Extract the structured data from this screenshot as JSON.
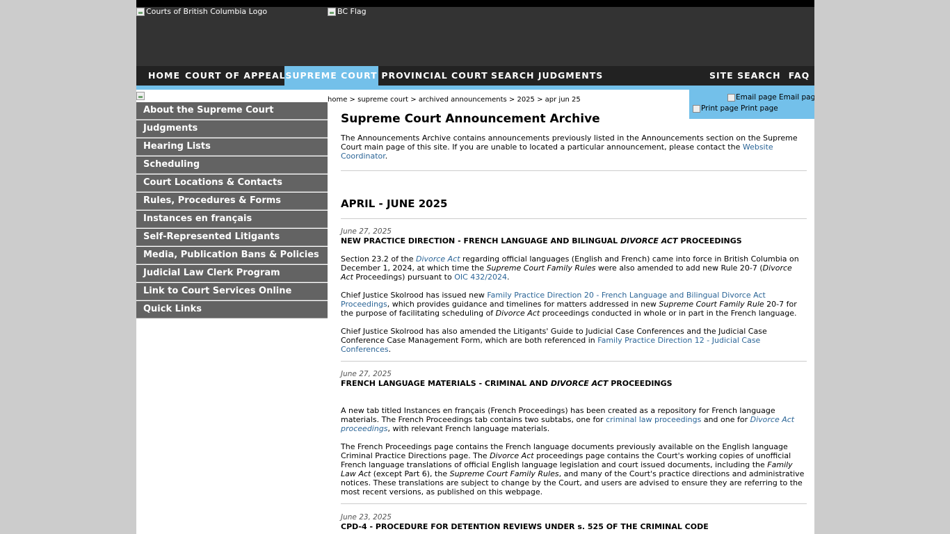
{
  "banner": {
    "logo_alt": "Courts of British Columbia Logo",
    "flag_alt": "BC Flag"
  },
  "nav": {
    "items": [
      "Home",
      "Court of Appeal",
      "Supreme Court",
      "Provincial Court",
      "Search Judgments"
    ],
    "right_items": [
      "Site Search",
      "FAQ"
    ],
    "active": "Supreme Court",
    "active_color": "#73c0ea"
  },
  "sidebar": {
    "items": [
      "About the Supreme Court",
      "Judgments",
      "Hearing Lists",
      "Scheduling",
      "Court Locations & Contacts",
      "Rules, Procedures & Forms",
      "Instances en français",
      "Self-Represented Litigants",
      "Media, Publication Bans & Policies",
      "Judicial Law Clerk Program",
      "Link to Court Services Online",
      "Quick Links"
    ]
  },
  "breadcrumb": [
    "home",
    "supreme court",
    "archived announcements",
    "2025",
    "apr jun 25"
  ],
  "tools": {
    "email": "Email page Email page",
    "print": "Print page Print page"
  },
  "content": {
    "title": "Supreme Court Announcement Archive",
    "intro_text": "The Announcements Archive contains announcements previously listed in the Announcements section on the Supreme Court main page of this site. If you are unable to located a particular announcement, please contact the ",
    "intro_link": "Website Coordinator",
    "section_heading": "APRIL - JUNE 2025",
    "announcements": [
      {
        "date": "June 27, 2025",
        "title_pre": "NEW PRACTICE DIRECTION - FRENCH LANGUAGE AND BILINGUAL ",
        "title_em": "DIVORCE ACT",
        "title_post": " PROCEEDINGS",
        "p1": {
          "a": "Section 23.2 of the ",
          "link1": "Divorce Act",
          "b": " regarding official languages (English and French) came into force in British Columbia on December 1, 2024, at which time the ",
          "em1": "Supreme Court Family Rules",
          "c": " were also amended to add new Rule 20-7 (",
          "em2": "Divorce Act",
          "d": " Proceedings) pursuant to ",
          "link2": "OIC 432/2024",
          "e": "."
        },
        "p2": {
          "a": "Chief Justice Skolrood has issued new ",
          "link1": "Family Practice Direction 20 - French Language and Bilingual Divorce Act Proceedings",
          "b": ", which provides guidance and timelines for matters addressed in new ",
          "em1": "Supreme Court Family Rule",
          "c": " 20-7 for the purpose of facilitating scheduling of ",
          "em2": "Divorce Act",
          "d": " proceedings conducted in whole or in part in the French language."
        },
        "p3": {
          "a": "Chief Justice Skolrood has also amended the Litigants' Guide to Judicial Case Conferences and the Judicial Case Conference Case Management Form, which are both referenced in ",
          "link1": "Family Practice Direction 12 - Judicial Case Conferences",
          "b": "."
        }
      },
      {
        "date": "June 27, 2025",
        "title_pre": "FRENCH LANGUAGE MATERIALS - CRIMINAL AND ",
        "title_em": "DIVORCE ACT",
        "title_post": " PROCEEDINGS",
        "p1": {
          "a": "A new tab titled Instances en français (French Proceedings) has been created as a repository for French language materials. The French Proceedings tab contains two subtabs, one for ",
          "link1": "criminal law proceedings",
          "b": " and one for ",
          "link2": "Divorce Act proceedings",
          "c": ", with relevant French language materials."
        },
        "p2": {
          "a": "The French Proceedings page contains the French language documents previously available on the English language Criminal Practice Directions page. The ",
          "em1": "Divorce Act",
          "b": " proceedings page contains the Court's working copies of unofficial French language translations of official English language legislation and court issued documents, including the ",
          "em2": "Family Law Act",
          "c": " (except Part 6), the ",
          "em3": "Supreme Court Family Rules",
          "d": ", and many of the Court's practice directions and administrative notices. These translations are subject to change by the Court, and users are advised to ensure they are referring to the most recent versions, as published on this webpage."
        }
      },
      {
        "date": "June 23, 2025",
        "title": "CPD-4 - PROCEDURE FOR DETENTION REVIEWS UNDER s. 525 OF THE CRIMINAL CODE"
      }
    ]
  }
}
